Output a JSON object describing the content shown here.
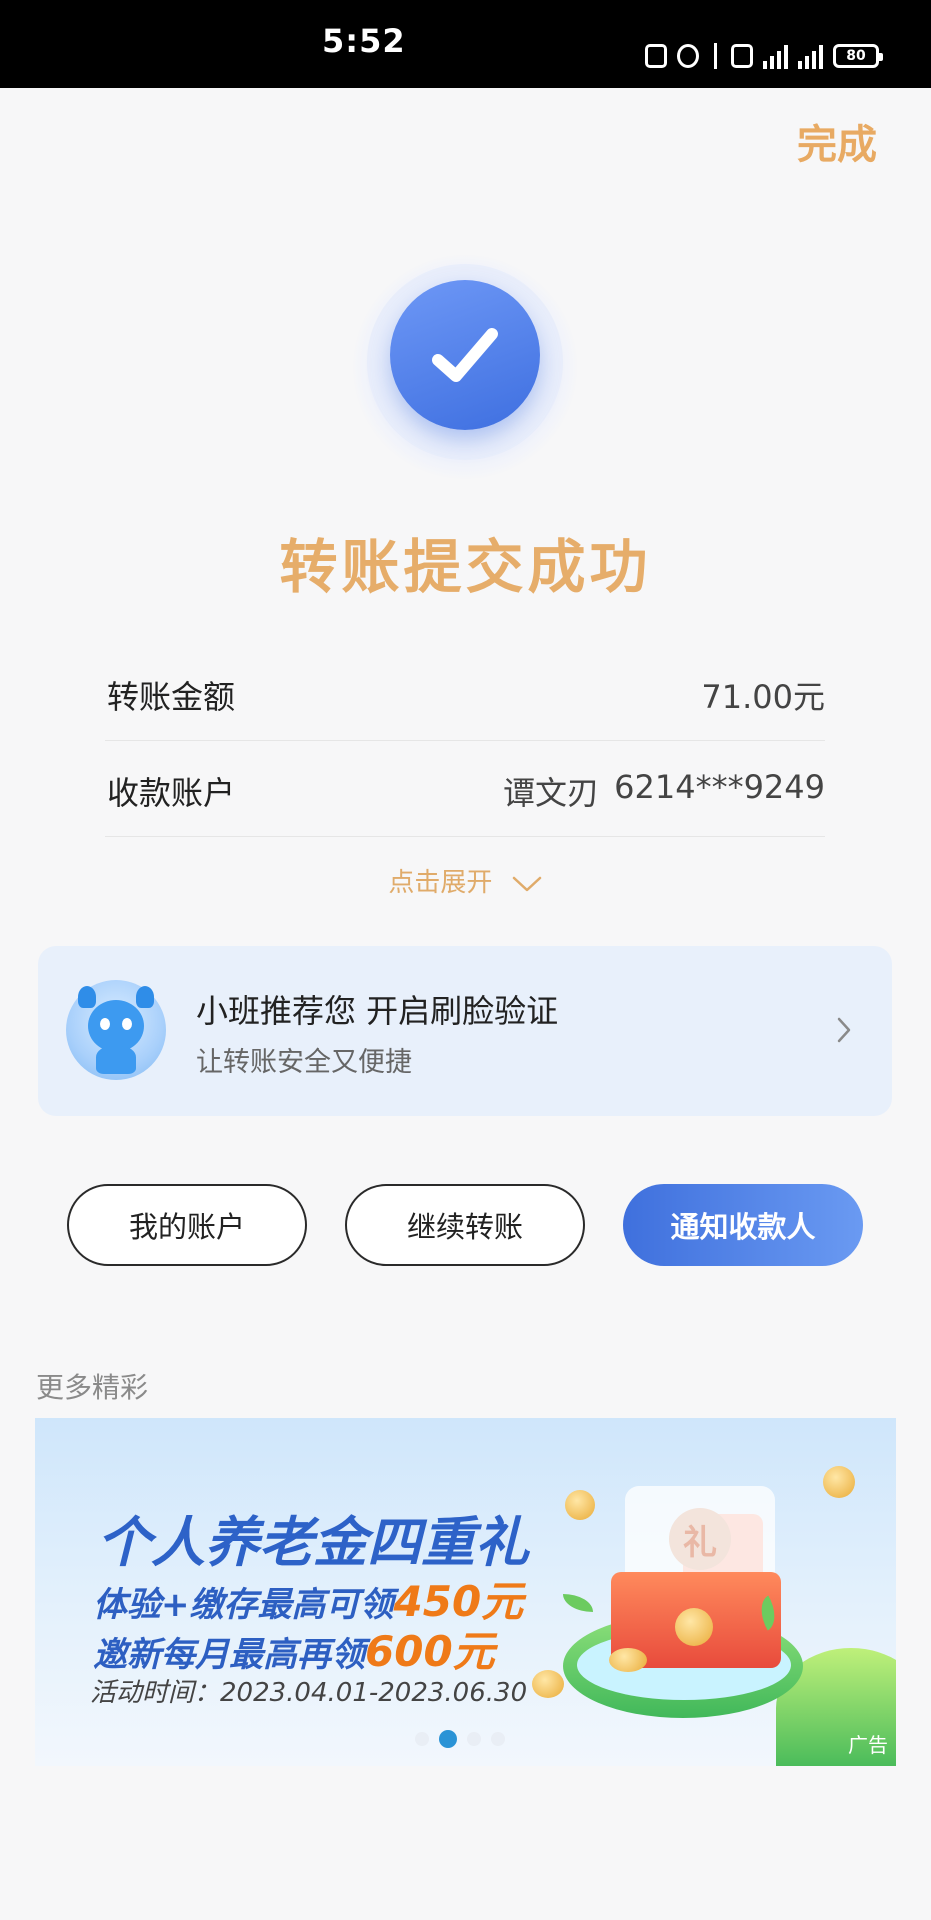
{
  "status_bar": {
    "time": "5:52",
    "battery": "80"
  },
  "header": {
    "done_label": "完成"
  },
  "result": {
    "title": "转账提交成功"
  },
  "details": [
    {
      "label": "转账金额",
      "value": "71.00元"
    },
    {
      "label": "收款账户",
      "name": "谭文刃",
      "value": "6214***9249"
    }
  ],
  "expand_label": "点击展开",
  "promo": {
    "title": "小班推荐您 开启刷脸验证",
    "subtitle": "让转账安全又便捷"
  },
  "actions": {
    "my_account": "我的账户",
    "continue_transfer": "继续转账",
    "notify_payee": "通知收款人"
  },
  "more": {
    "section_label": "更多精彩"
  },
  "banner": {
    "title": "个人养老金四重礼",
    "line1_prefix": "体验+缴存最高可领",
    "line1_amount": "450元",
    "line2_prefix": "邀新每月最高再领",
    "line2_amount": "600元",
    "date": "活动时间：2023.04.01-2023.06.30",
    "gift_char": "礼",
    "ad_tag": "广告",
    "active_slide": 2,
    "slide_count": 4
  },
  "colors": {
    "accent_gold": "#e6ad6a",
    "primary_blue": "#3f70dd"
  }
}
